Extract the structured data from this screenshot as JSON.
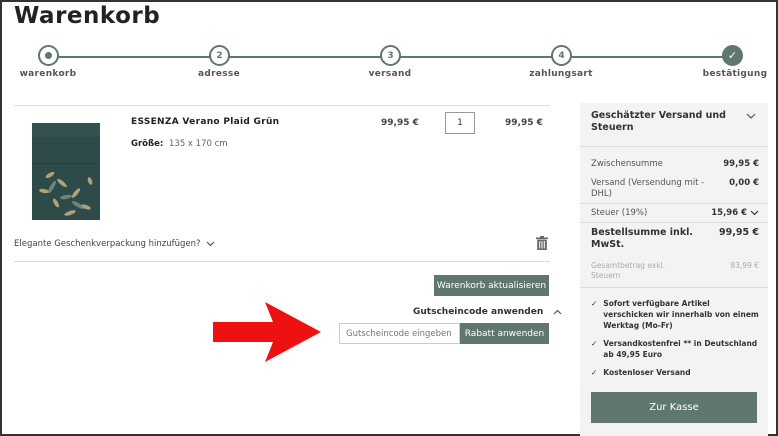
{
  "page": {
    "title": "Warenkorb"
  },
  "steps": [
    {
      "number": "",
      "label": "warenkorb",
      "state": "active"
    },
    {
      "number": "2",
      "label": "adresse",
      "state": "pending"
    },
    {
      "number": "3",
      "label": "versand",
      "state": "pending"
    },
    {
      "number": "4",
      "label": "zahlungsart",
      "state": "pending"
    },
    {
      "number": "✓",
      "label": "bestätigung",
      "state": "done"
    }
  ],
  "cart": {
    "item": {
      "name": "ESSENZA Verano Plaid Grün",
      "size_label": "Größe:",
      "size_value": "135 x 170 cm",
      "unit_price": "99,95 €",
      "quantity": "1",
      "total_price": "99,95 €"
    },
    "gift_wrap_label": "Elegante Geschenkverpackung hinzufügen?",
    "update_button": "Warenkorb aktualisieren",
    "coupon": {
      "title": "Gutscheincode anwenden",
      "placeholder": "Gutscheincode eingeben",
      "apply_button": "Rabatt anwenden"
    }
  },
  "summary": {
    "heading": "Geschätzter Versand und Steuern",
    "subtotal_label": "Zwischensumme",
    "subtotal_value": "99,95 €",
    "shipping_label": "Versand (Versendung mit - DHL)",
    "shipping_value": "0,00 €",
    "tax_label": "Steuer (19%)",
    "tax_value": "15,96 €",
    "total_label": "Bestellsumme inkl. MwSt.",
    "total_value": "99,95 €",
    "net_label": "Gesamtbetrag exkl. Steuern",
    "net_value": "83,99 €",
    "features": [
      "Sofort verfügbare Artikel verschicken wir innerhalb von einem Werktag (Mo-Fr)",
      "Versandkostenfrei ** in Deutschland ab 49,95 Euro",
      "Kostenloser Versand"
    ],
    "checkout_button": "Zur Kasse"
  },
  "colors": {
    "accent": "#5f7770",
    "arrow": "#ee1111"
  },
  "icons": [
    "trash-icon",
    "chevron-down-icon",
    "chevron-up-icon",
    "check-icon",
    "arrow-right-icon"
  ]
}
